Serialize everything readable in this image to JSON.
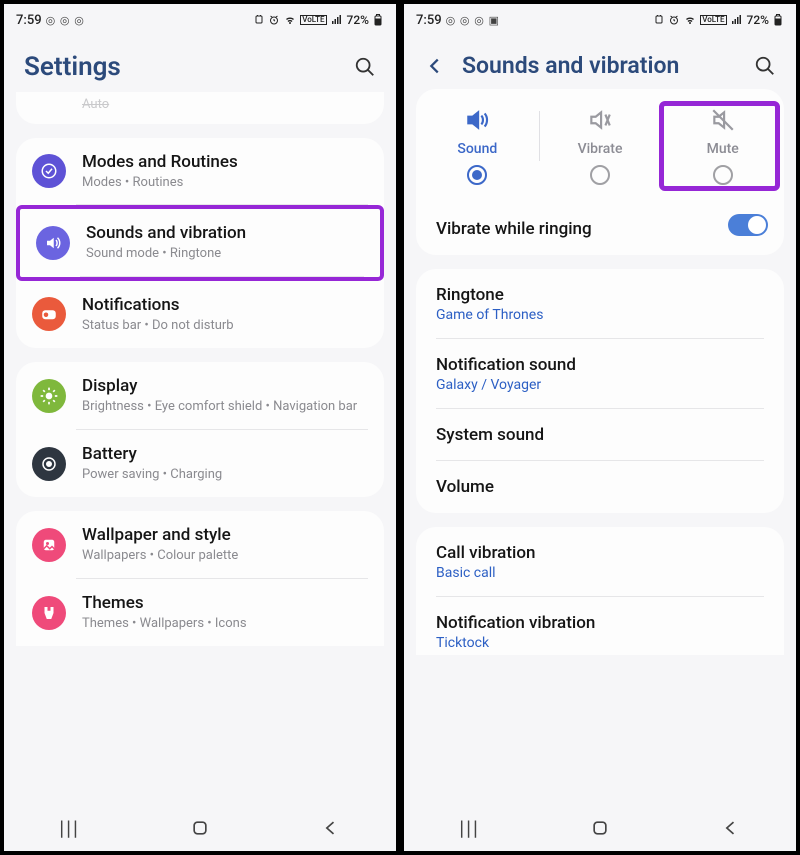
{
  "status": {
    "time": "7:59",
    "battery": "72%"
  },
  "left": {
    "title": "Settings",
    "cut_item_sub": "Auto",
    "items": [
      {
        "title": "Modes and Routines",
        "sub": "Modes  •  Routines",
        "color": "#5e52d6"
      },
      {
        "title": "Sounds and vibration",
        "sub": "Sound mode  •  Ringtone",
        "color": "#6b64e0"
      },
      {
        "title": "Notifications",
        "sub": "Status bar  •  Do not disturb",
        "color": "#ea5a3c"
      }
    ],
    "group2": [
      {
        "title": "Display",
        "sub": "Brightness  •  Eye comfort shield  •  Navigation bar",
        "color": "#7fb83c"
      },
      {
        "title": "Battery",
        "sub": "Power saving  •  Charging",
        "color": "#2e3640"
      }
    ],
    "group3": [
      {
        "title": "Wallpaper and style",
        "sub": "Wallpapers  •  Colour palette",
        "color": "#ef4a7a"
      },
      {
        "title": "Themes",
        "sub": "Themes  •  Wallpapers  •  Icons",
        "color": "#ef4a7a"
      }
    ]
  },
  "right": {
    "title": "Sounds and vibration",
    "modes": {
      "sound": "Sound",
      "vibrate": "Vibrate",
      "mute": "Mute"
    },
    "vibrate_ringing": "Vibrate while ringing",
    "ringtone": {
      "title": "Ringtone",
      "value": "Game of Thrones"
    },
    "notif_sound": {
      "title": "Notification sound",
      "value": "Galaxy / Voyager"
    },
    "system_sound": "System sound",
    "volume": "Volume",
    "call_vib": {
      "title": "Call vibration",
      "value": "Basic call"
    },
    "notif_vib": {
      "title": "Notification vibration",
      "value": "Ticktock"
    }
  }
}
